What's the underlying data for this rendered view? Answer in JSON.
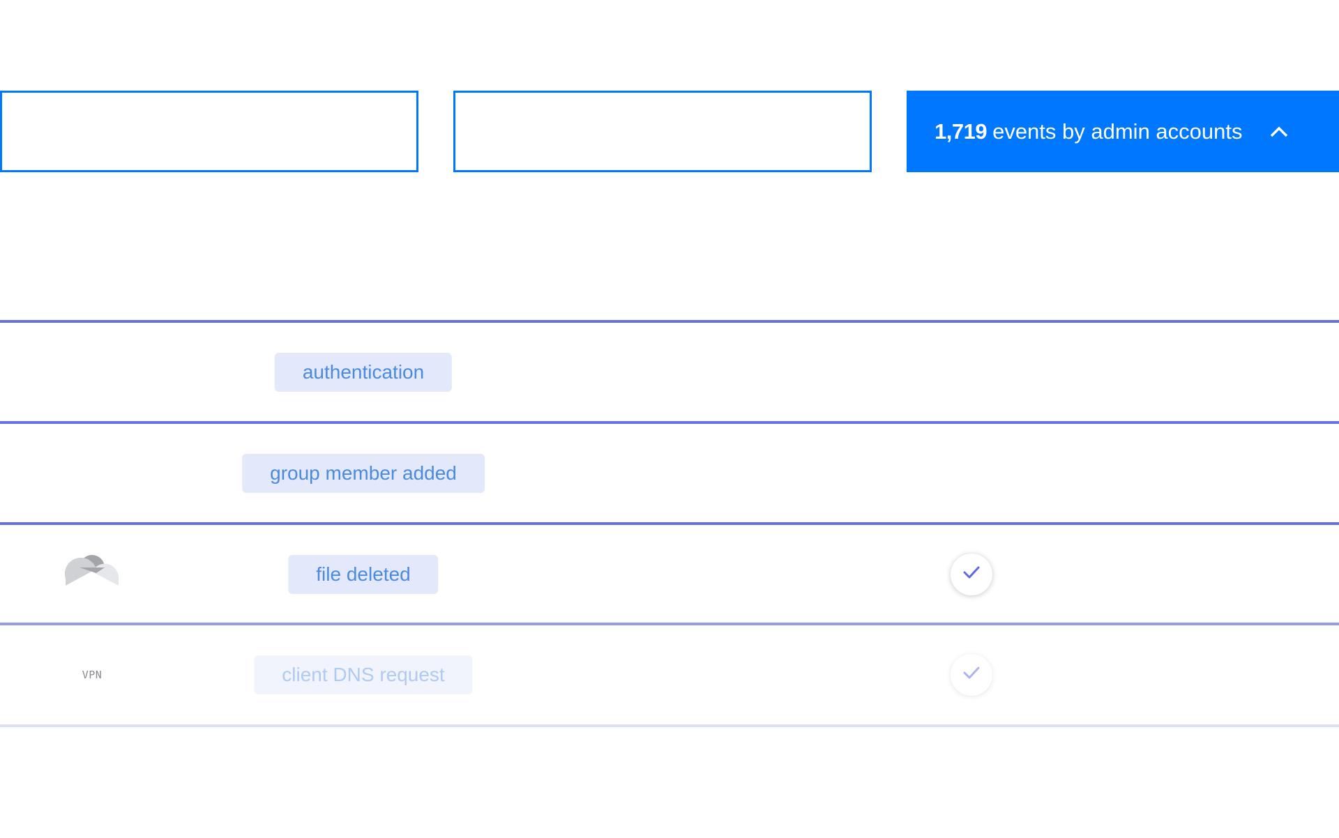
{
  "summary_boxes": [
    {
      "id": "box-1",
      "count": "",
      "label": "",
      "active": false
    },
    {
      "id": "box-2",
      "count": "",
      "label": "",
      "active": false
    },
    {
      "id": "box-3",
      "count": "1,719",
      "label": "events by admin accounts",
      "active": true,
      "expanded_icon": "chevron-up-icon"
    }
  ],
  "events": [
    {
      "source_icon": "",
      "source_label": "",
      "event_type": "authentication",
      "checked": false,
      "faded": false
    },
    {
      "source_icon": "",
      "source_label": "",
      "event_type": "group member added",
      "checked": false,
      "faded": false
    },
    {
      "source_icon": "cloud-drive-icon",
      "source_label": "",
      "event_type": "file deleted",
      "checked": true,
      "faded": false
    },
    {
      "source_icon": "vpn-icon",
      "source_label": "VPN",
      "event_type": "client DNS request",
      "checked": true,
      "faded": true
    }
  ],
  "colors": {
    "accent": "#0077FF",
    "divider": "#6770E0",
    "divider_light": "#959BE8",
    "divider_faint": "#DDE0F5",
    "pill_bg": "#E3E9FB",
    "pill_text": "#4A8BE0",
    "check": "#5F68E0"
  }
}
